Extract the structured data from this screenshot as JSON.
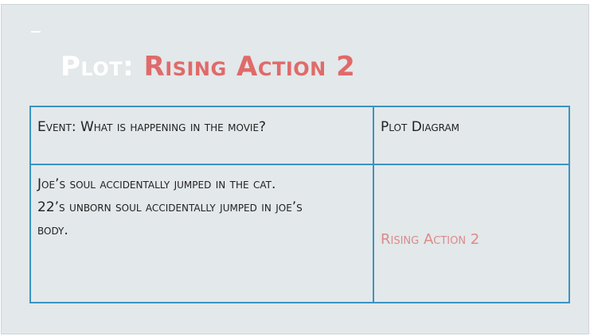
{
  "slide": {
    "title_prefix": "Plot:",
    "title_suffix": "Rising Action 2",
    "colors": {
      "background": "#e3e8ea",
      "title_accent": "#e06a6a",
      "table_border": "#3a94c3",
      "diagram_label": "#d98b8b"
    }
  },
  "table": {
    "headers": [
      "Event: What is happening in the movie?",
      "Plot Diagram"
    ],
    "event_lines": [
      "Joe’s soul accidentally jumped in the cat.",
      "22’s unborn soul accidentally jumped in joe’s",
      "body."
    ],
    "diagram_label": "Rising Action 2"
  }
}
